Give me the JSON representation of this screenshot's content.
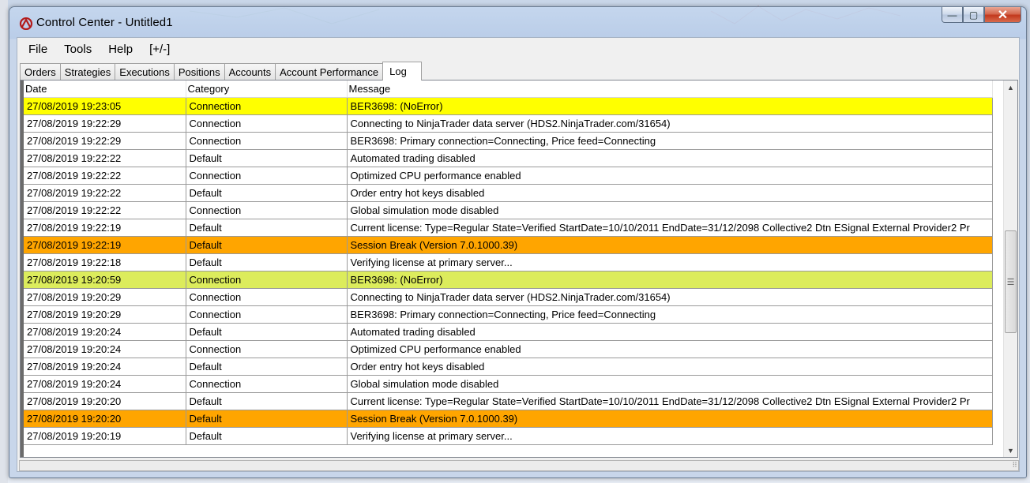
{
  "window": {
    "title": "Control Center - Untitled1",
    "minimize_label": "—",
    "restore_label": "▢",
    "close_label": "✕"
  },
  "menu": [
    "File",
    "Tools",
    "Help",
    "[+/-]"
  ],
  "tabs": [
    {
      "label": "Orders",
      "active": false
    },
    {
      "label": "Strategies",
      "active": false
    },
    {
      "label": "Executions",
      "active": false
    },
    {
      "label": "Positions",
      "active": false
    },
    {
      "label": "Accounts",
      "active": false
    },
    {
      "label": "Account Performance",
      "active": false
    },
    {
      "label": "Log",
      "active": true
    }
  ],
  "log_grid": {
    "columns": [
      "Date",
      "Category",
      "Message"
    ],
    "highlight_colors": {
      "connection_ok": "#ffff00",
      "session_break": "#ffa500",
      "connection_ok_alt": "#dcec5c",
      "default": "#ffffff"
    },
    "rows": [
      {
        "date": "27/08/2019 19:23:05",
        "category": "Connection",
        "message": "BER3698: (NoError)",
        "highlight": "connection_ok"
      },
      {
        "date": "27/08/2019 19:22:29",
        "category": "Connection",
        "message": "Connecting to NinjaTrader data server (HDS2.NinjaTrader.com/31654)",
        "highlight": "default"
      },
      {
        "date": "27/08/2019 19:22:29",
        "category": "Connection",
        "message": "BER3698: Primary connection=Connecting, Price feed=Connecting",
        "highlight": "default"
      },
      {
        "date": "27/08/2019 19:22:22",
        "category": "Default",
        "message": "Automated trading disabled",
        "highlight": "default"
      },
      {
        "date": "27/08/2019 19:22:22",
        "category": "Connection",
        "message": "Optimized CPU performance enabled",
        "highlight": "default"
      },
      {
        "date": "27/08/2019 19:22:22",
        "category": "Default",
        "message": "Order entry hot keys disabled",
        "highlight": "default"
      },
      {
        "date": "27/08/2019 19:22:22",
        "category": "Connection",
        "message": "Global simulation mode disabled",
        "highlight": "default"
      },
      {
        "date": "27/08/2019 19:22:19",
        "category": "Default",
        "message": "Current license: Type=Regular State=Verified StartDate=10/10/2011 EndDate=31/12/2098 Collective2 Dtn ESignal External Provider2 Pr",
        "highlight": "default"
      },
      {
        "date": "27/08/2019 19:22:19",
        "category": "Default",
        "message": "Session Break (Version 7.0.1000.39)",
        "highlight": "session_break"
      },
      {
        "date": "27/08/2019 19:22:18",
        "category": "Default",
        "message": "Verifying license at primary server...",
        "highlight": "default"
      },
      {
        "date": "27/08/2019 19:20:59",
        "category": "Connection",
        "message": "BER3698: (NoError)",
        "highlight": "connection_ok_alt"
      },
      {
        "date": "27/08/2019 19:20:29",
        "category": "Connection",
        "message": "Connecting to NinjaTrader data server (HDS2.NinjaTrader.com/31654)",
        "highlight": "default"
      },
      {
        "date": "27/08/2019 19:20:29",
        "category": "Connection",
        "message": "BER3698: Primary connection=Connecting, Price feed=Connecting",
        "highlight": "default"
      },
      {
        "date": "27/08/2019 19:20:24",
        "category": "Default",
        "message": "Automated trading disabled",
        "highlight": "default"
      },
      {
        "date": "27/08/2019 19:20:24",
        "category": "Connection",
        "message": "Optimized CPU performance enabled",
        "highlight": "default"
      },
      {
        "date": "27/08/2019 19:20:24",
        "category": "Default",
        "message": "Order entry hot keys disabled",
        "highlight": "default"
      },
      {
        "date": "27/08/2019 19:20:24",
        "category": "Connection",
        "message": "Global simulation mode disabled",
        "highlight": "default"
      },
      {
        "date": "27/08/2019 19:20:20",
        "category": "Default",
        "message": "Current license: Type=Regular State=Verified StartDate=10/10/2011 EndDate=31/12/2098 Collective2 Dtn ESignal External Provider2 Pr",
        "highlight": "default"
      },
      {
        "date": "27/08/2019 19:20:20",
        "category": "Default",
        "message": "Session Break (Version 7.0.1000.39)",
        "highlight": "session_break"
      },
      {
        "date": "27/08/2019 19:20:19",
        "category": "Default",
        "message": "Verifying license at primary server...",
        "highlight": "default"
      }
    ]
  },
  "scrollbar": {
    "up_icon": "▲",
    "down_icon": "▼",
    "thumb_grip_icon": "☰"
  },
  "statusbar": {
    "grip_icon": "⠿"
  }
}
